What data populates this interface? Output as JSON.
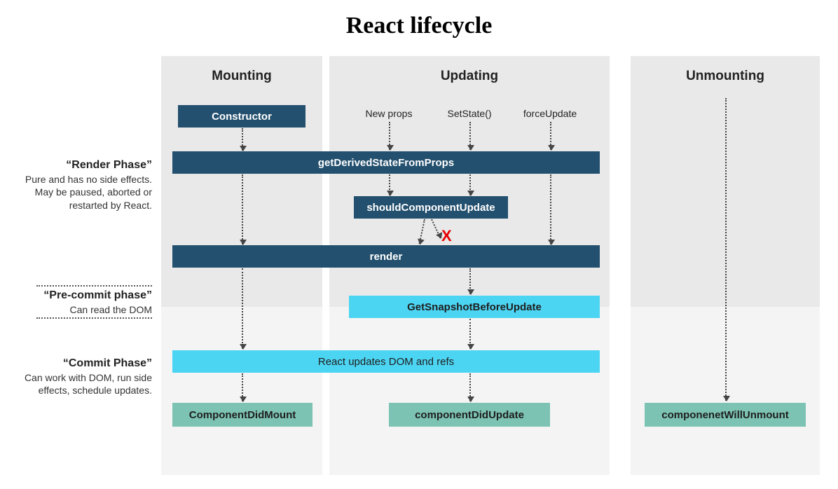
{
  "title": "React lifecycle",
  "columns": {
    "mounting": "Mounting",
    "updating": "Updating",
    "unmounting": "Unmounting"
  },
  "phases": {
    "render": {
      "title": "“Render Phase”",
      "desc": "Pure and has no side effects. May be paused, aborted or restarted by React."
    },
    "precommit": {
      "title": "“Pre-commit phase”",
      "desc": "Can read the DOM"
    },
    "commit": {
      "title": "“Commit Phase”",
      "desc": "Can work with DOM, run side effects, schedule updates."
    }
  },
  "triggers": {
    "newProps": "New props",
    "setState": "SetState()",
    "forceUpdate": "forceUpdate"
  },
  "boxes": {
    "constructor": "Constructor",
    "getDerived": "getDerivedStateFromProps",
    "shouldUpdate": "shouldComponentUpdate",
    "render": "render",
    "getSnapshot": "GetSnapshotBeforeUpdate",
    "updatesDom": "React updates DOM and refs",
    "didMount": "ComponentDidMount",
    "didUpdate": "componentDidUpdate",
    "willUnmount": "componenetWillUnmount"
  },
  "xMark": "X"
}
